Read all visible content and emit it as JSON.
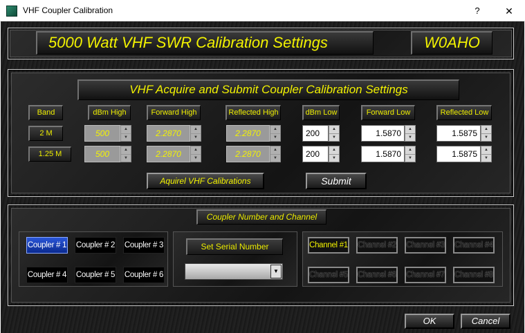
{
  "window": {
    "title": "VHF Coupler Calibration",
    "help": "?",
    "close": "✕"
  },
  "header": {
    "title": "5000 Watt  VHF SWR Calibration Settings",
    "callsign": "W0AHO"
  },
  "acquire": {
    "title": "VHF Acquire and Submit Coupler Calibration Settings",
    "columns": [
      "Band",
      "dBm High",
      "Forward High",
      "Reflected High",
      "dBm Low",
      "Forward Low",
      "Reflected Low"
    ],
    "rows": [
      {
        "band": "2 M",
        "dbm_high": "500",
        "forward_high": "2.2870",
        "reflected_high": "2.2870",
        "dbm_low": "200",
        "forward_low": "1.5870",
        "reflected_low": "1.5875"
      },
      {
        "band": "1.25 M",
        "dbm_high": "500",
        "forward_high": "2.2870",
        "reflected_high": "2.2870",
        "dbm_low": "200",
        "forward_low": "1.5870",
        "reflected_low": "1.5875"
      }
    ],
    "acquire_button": "Aquirel VHF Calibrations",
    "submit_button": "Submit"
  },
  "coupler": {
    "title": "Coupler Number and Channel",
    "couplers": [
      "Coupler # 1",
      "Coupler # 2",
      "Coupler # 3",
      "Coupler # 4",
      "Coupler # 5",
      "Coupler # 6"
    ],
    "serial_label": "Set Serial Number",
    "serial_value": "",
    "channels": [
      "Channel #1",
      "Channel #2",
      "Channel #3",
      "Channel #4",
      "Channel #5",
      "Channel #6",
      "Channel #7",
      "Channel #8"
    ]
  },
  "footer": {
    "ok": "OK",
    "cancel": "Cancel"
  }
}
